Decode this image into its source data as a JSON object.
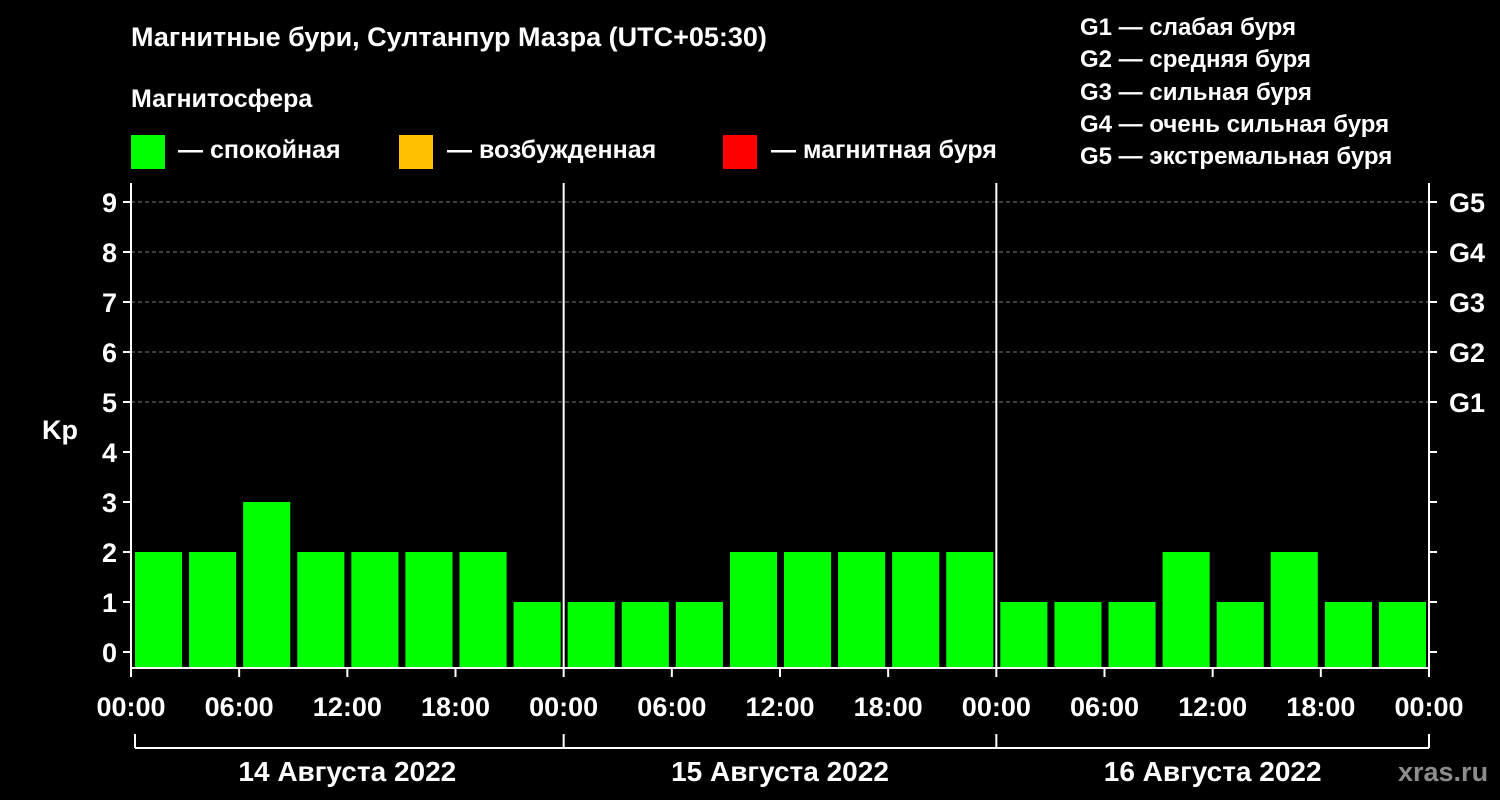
{
  "title": "Магнитные бури, Султанпур Мазра (UTC+05:30)",
  "magnetosphere": {
    "title": "Магнитосфера",
    "items": [
      {
        "label": "— спокойная",
        "color": "#00ff00"
      },
      {
        "label": "— возбужденная",
        "color": "#ffc000"
      },
      {
        "label": "— магнитная буря",
        "color": "#ff0000"
      }
    ]
  },
  "storm_levels": [
    "G1 — слабая буря",
    "G2 — средняя буря",
    "G3 — сильная буря",
    "G4 — очень сильная буря",
    "G5 — экстремальная буря"
  ],
  "watermark": "xras.ru",
  "chart_data": {
    "type": "bar",
    "ylabel": "Kp",
    "ylim": [
      0,
      9
    ],
    "yticks": [
      0,
      1,
      2,
      3,
      4,
      5,
      6,
      7,
      8,
      9
    ],
    "right_ticks": [
      {
        "value": 5,
        "label": "G1"
      },
      {
        "value": 6,
        "label": "G2"
      },
      {
        "value": 7,
        "label": "G3"
      },
      {
        "value": 8,
        "label": "G4"
      },
      {
        "value": 9,
        "label": "G5"
      }
    ],
    "grid": "dashed at 5–9",
    "xticks": [
      "00:00",
      "06:00",
      "12:00",
      "18:00",
      "00:00",
      "06:00",
      "12:00",
      "18:00",
      "00:00",
      "06:00",
      "12:00",
      "18:00",
      "00:00"
    ],
    "days": [
      "14 Августа 2022",
      "15 Августа 2022",
      "16 Августа 2022"
    ],
    "interval_hours": 3,
    "values": [
      2,
      2,
      3,
      2,
      2,
      2,
      2,
      1,
      1,
      1,
      1,
      2,
      2,
      2,
      2,
      2,
      1,
      1,
      1,
      2,
      1,
      2,
      1,
      1
    ],
    "bar_color": "#00ff00"
  }
}
